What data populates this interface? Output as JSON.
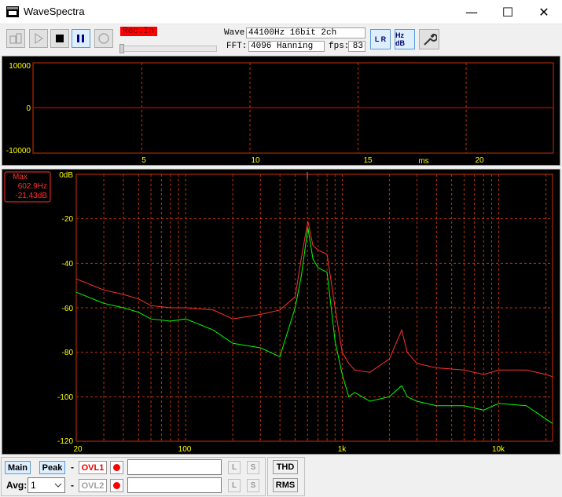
{
  "window": {
    "title": "WaveSpectra",
    "minimize_glyph": "—",
    "maximize_glyph": "☐",
    "close_glyph": "✕"
  },
  "toolbar": {
    "rec_input_label": "Rec.In.",
    "wave_label": "Wave:",
    "wave_value": "44100Hz 16bit 2ch",
    "fft_label": "FFT:",
    "fft_value": "4096 Hanning",
    "fps_label": "fps:",
    "fps_value": "83",
    "lr_button": "L R",
    "hz_db_button": "Hz dB"
  },
  "waveform": {
    "y_ticks": [
      "10000",
      "0",
      "-10000"
    ],
    "x_ticks": [
      "5",
      "10",
      "15",
      "20"
    ],
    "x_unit": "ms",
    "trace_color": "#ff0000",
    "grid_color": "#c83200",
    "text_color": "#ffff00"
  },
  "spectrum": {
    "peak_box": {
      "line1": "Max",
      "line2": "602.9Hz",
      "line3": "-21.43dB"
    },
    "y_ticks": [
      "0dB",
      "-20",
      "-40",
      "-60",
      "-80",
      "-100",
      "-120"
    ],
    "x_ticks": [
      "20",
      "100",
      "1k",
      "10k"
    ],
    "channel_colors": {
      "left": "#ff3030",
      "right": "#00ff00"
    }
  },
  "bottom": {
    "main_label": "Main",
    "peak_label": "Peak",
    "avg_label": "Avg:",
    "avg_value": "1",
    "ovl1_label": "OVL1",
    "ovl2_label": "OVL2",
    "dash": "-",
    "l_label": "L",
    "s_label": "S",
    "thd_label": "THD",
    "rms_label": "RMS"
  },
  "chart_data": [
    {
      "type": "line",
      "title": "",
      "xlabel": "ms",
      "ylabel": "",
      "xlim": [
        0,
        24
      ],
      "ylim": [
        -10000,
        10000
      ],
      "series": [
        {
          "x": [
            0,
            24
          ],
          "values": [
            0,
            0
          ]
        }
      ]
    },
    {
      "type": "line",
      "title": "",
      "xlabel": "",
      "ylabel": "",
      "x_scale": "log",
      "xlim": [
        20,
        22050
      ],
      "ylim": [
        -120,
        0
      ],
      "series": [
        {
          "x": [
            20,
            30,
            40,
            50,
            60,
            80,
            100,
            150,
            200,
            300,
            400,
            500,
            550,
            603,
            650,
            700,
            800,
            900,
            1000,
            1100,
            1200,
            1500,
            2000,
            2400,
            2600,
            3000,
            4000,
            6000,
            8000,
            10000,
            15000,
            20000,
            22050
          ],
          "values": [
            -47,
            -52,
            -54,
            -56,
            -59,
            -60,
            -60,
            -61,
            -65,
            -63,
            -61,
            -55,
            -37,
            -21,
            -32,
            -34,
            -36,
            -60,
            -80,
            -85,
            -88,
            -89,
            -83,
            -70,
            -80,
            -85,
            -87,
            -88,
            -90,
            -88,
            -88,
            -90,
            -91
          ]
        },
        {
          "x": [
            20,
            30,
            40,
            50,
            60,
            80,
            100,
            150,
            200,
            300,
            400,
            500,
            550,
            603,
            650,
            700,
            800,
            900,
            1000,
            1100,
            1200,
            1500,
            2000,
            2400,
            2600,
            3000,
            4000,
            6000,
            8000,
            10000,
            15000,
            20000,
            22050
          ],
          "values": [
            -53,
            -58,
            -60,
            -62,
            -65,
            -66,
            -65,
            -70,
            -76,
            -78,
            -82,
            -60,
            -45,
            -24,
            -38,
            -42,
            -44,
            -75,
            -90,
            -100,
            -98,
            -102,
            -100,
            -95,
            -100,
            -102,
            -104,
            -104,
            -106,
            -103,
            -104,
            -110,
            -112
          ]
        }
      ]
    }
  ]
}
